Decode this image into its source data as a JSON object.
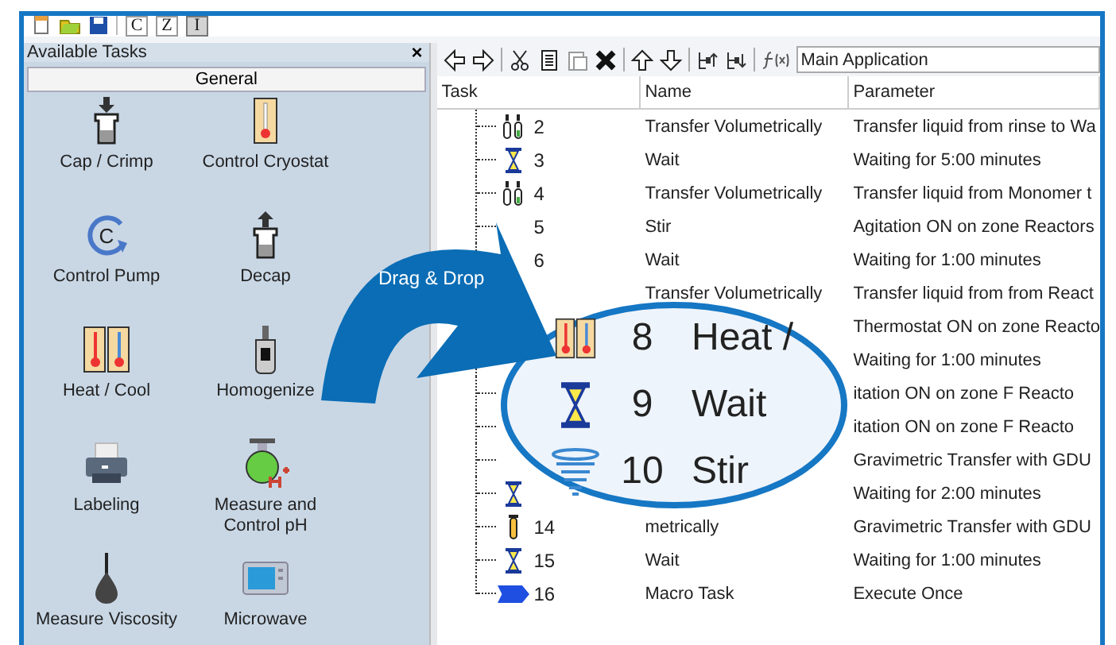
{
  "toolbar": {
    "letter_buttons": [
      {
        "label": "C",
        "selected": false
      },
      {
        "label": "Z",
        "selected": false
      },
      {
        "label": "I",
        "selected": true
      }
    ]
  },
  "tasks_panel": {
    "title": "Available Tasks",
    "close": "×",
    "group": "General",
    "tiles": [
      {
        "kind": "cap",
        "label": "Cap / Crimp"
      },
      {
        "kind": "thermometer",
        "label": "Control Cryostat"
      },
      {
        "kind": "pump",
        "glyph": "C",
        "label": "Control Pump"
      },
      {
        "kind": "decap",
        "label": "Decap"
      },
      {
        "kind": "heatcool",
        "label": "Heat / Cool"
      },
      {
        "kind": "homogenizer",
        "label": "Homogenize"
      },
      {
        "kind": "printer",
        "label": "Labeling"
      },
      {
        "kind": "flask",
        "label": "Measure and Control pH"
      },
      {
        "kind": "drop",
        "label": "Measure Viscosity"
      },
      {
        "kind": "microwave",
        "label": "Microwave"
      }
    ]
  },
  "editor": {
    "scope_field": {
      "value": "Main Application"
    },
    "columns": [
      "Task",
      "Name",
      "Parameter"
    ],
    "rows": [
      {
        "kind": "transfer",
        "number": "2",
        "name": "Transfer Volumetrically",
        "parameter": "Transfer liquid from rinse to Wa"
      },
      {
        "kind": "wait",
        "number": "3",
        "name": "Wait",
        "parameter": "Waiting for 5:00 minutes"
      },
      {
        "kind": "transfer",
        "number": "4",
        "name": "Transfer Volumetrically",
        "parameter": "Transfer liquid from Monomer t"
      },
      {
        "number": "5",
        "name": "Stir",
        "parameter": "Agitation ON on zone Reactors"
      },
      {
        "number": "6",
        "name": "Wait",
        "parameter": "Waiting for 1:00 minutes"
      },
      {
        "name": "Transfer Volumetrically",
        "parameter": "Transfer liquid from from React"
      },
      {
        "parameter": "Thermostat ON on zone Reacto"
      },
      {
        "parameter": "Waiting for 1:00 minutes"
      },
      {
        "parameter": "itation ON on zone F Reacto"
      },
      {
        "parameter": "itation ON on zone F Reacto"
      },
      {
        "parameter": "Gravimetric Transfer with GDU"
      },
      {
        "kind": "wait",
        "parameter": "Waiting for 2:00 minutes"
      },
      {
        "kind": "vial",
        "number": "14",
        "name": "metrically",
        "parameter": "Gravimetric Transfer with GDU"
      },
      {
        "kind": "wait",
        "number": "15",
        "name": "Wait",
        "parameter": "Waiting for 1:00 minutes"
      },
      {
        "kind": "macro",
        "number": "16",
        "name": "Macro Task",
        "parameter": "Execute Once"
      }
    ]
  },
  "callout": {
    "label": "Drag & Drop"
  },
  "magnifier": {
    "rows": [
      {
        "kind": "heatcool",
        "number": "8",
        "name": "Heat /"
      },
      {
        "kind": "wait",
        "number": "9",
        "name": "Wait"
      },
      {
        "kind": "stir",
        "number": "10",
        "name": "Stir"
      }
    ]
  }
}
